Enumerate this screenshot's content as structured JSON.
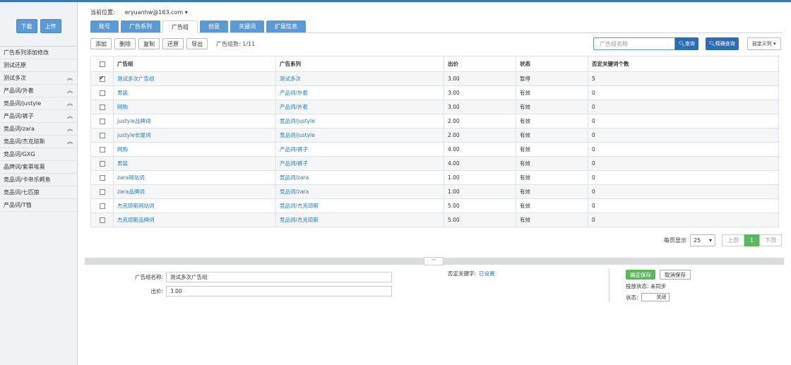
{
  "sidebar": {
    "download_label": "下载",
    "upload_label": "上传",
    "items": [
      {
        "label": "广告系列添加修改",
        "collapse": false
      },
      {
        "label": "测试还原",
        "collapse": false
      },
      {
        "label": "测试多次",
        "collapse": true
      },
      {
        "label": "产品词/外套",
        "collapse": true
      },
      {
        "label": "竞品词/justyle",
        "collapse": true
      },
      {
        "label": "产品词/裤子",
        "collapse": true
      },
      {
        "label": "竞品词/zara",
        "collapse": true
      },
      {
        "label": "竞品词/杰克琼斯",
        "collapse": true
      },
      {
        "label": "竞品词/GXG",
        "collapse": false
      },
      {
        "label": "品牌词/紫蒂埃莫",
        "collapse": false
      },
      {
        "label": "竞品词/卡帝乐鳄鱼",
        "collapse": false
      },
      {
        "label": "竞品词/七匹狼",
        "collapse": false
      },
      {
        "label": "产品词/T恤",
        "collapse": false
      }
    ]
  },
  "breadcrumb": {
    "label": "当前位置:",
    "user": "eryuanhw@163.com ▾"
  },
  "tabs": [
    "账号",
    "广告系列",
    "广告组",
    "创意",
    "关键词",
    "扩展信息"
  ],
  "active_tab": 2,
  "toolbar": {
    "add": "添加",
    "delete": "删除",
    "copy": "复制",
    "restore": "还原",
    "export": "导出",
    "count_label": "广告组数: 1/11"
  },
  "search": {
    "placeholder": "广告组名称",
    "query_label": "查询",
    "precise_label": "精确查询",
    "custom_label": "自定义列 ▾"
  },
  "table": {
    "headers": [
      "广告组",
      "广告系列",
      "出价",
      "状态",
      "否定关键词个数"
    ],
    "rows": [
      {
        "checked": true,
        "group": "测试多次广告组",
        "series": "测试多次",
        "bid": "3.00",
        "status": "暂停",
        "neg": "5"
      },
      {
        "checked": false,
        "group": "男装",
        "series": "产品词/外套",
        "bid": "3.00",
        "status": "有效",
        "neg": "0"
      },
      {
        "checked": false,
        "group": "网购",
        "series": "产品词/外套",
        "bid": "3.00",
        "status": "有效",
        "neg": "0"
      },
      {
        "checked": false,
        "group": "justyle品牌词",
        "series": "竞品词/justyle",
        "bid": "2.00",
        "status": "有效",
        "neg": "0"
      },
      {
        "checked": false,
        "group": "justyle长尾词",
        "series": "竞品词/justyle",
        "bid": "2.00",
        "status": "有效",
        "neg": "0"
      },
      {
        "checked": false,
        "group": "网购",
        "series": "产品词/裤子",
        "bid": "4.00",
        "status": "有效",
        "neg": "0"
      },
      {
        "checked": false,
        "group": "男装",
        "series": "产品词/裤子",
        "bid": "4.00",
        "status": "有效",
        "neg": "0"
      },
      {
        "checked": false,
        "group": "zara网站词",
        "series": "竞品词/zara",
        "bid": "1.00",
        "status": "有效",
        "neg": "0"
      },
      {
        "checked": false,
        "group": "zara品牌词",
        "series": "竞品词/zara",
        "bid": "1.00",
        "status": "有效",
        "neg": "0"
      },
      {
        "checked": false,
        "group": "杰克琼斯网站词",
        "series": "竞品词/杰克琼斯",
        "bid": "5.00",
        "status": "有效",
        "neg": "0"
      },
      {
        "checked": false,
        "group": "杰克琼斯品牌词",
        "series": "竞品词/杰克琼斯",
        "bid": "5.00",
        "status": "有效",
        "neg": "0"
      }
    ]
  },
  "pager": {
    "per_page_label": "每页显示",
    "per_page": "25",
    "prev": "上页",
    "current": "1",
    "next": "下页"
  },
  "detail": {
    "name_label": "广告组名称:",
    "name_value": "测试多次广告组",
    "bid_label": "出价:",
    "bid_value": "3.00",
    "neg_label": "否定关键字:",
    "neg_link": "已设置",
    "save_label": "确定保存",
    "cancel_label": "取消保存",
    "sync_label": "投放状态: 未同步",
    "state_label": "状态:",
    "toggle_label": "关闭"
  },
  "colors": {
    "primary": "#5b9bd5",
    "dark_primary": "#2d6db5",
    "success": "#5cb85c",
    "link": "#2a7ab8"
  }
}
